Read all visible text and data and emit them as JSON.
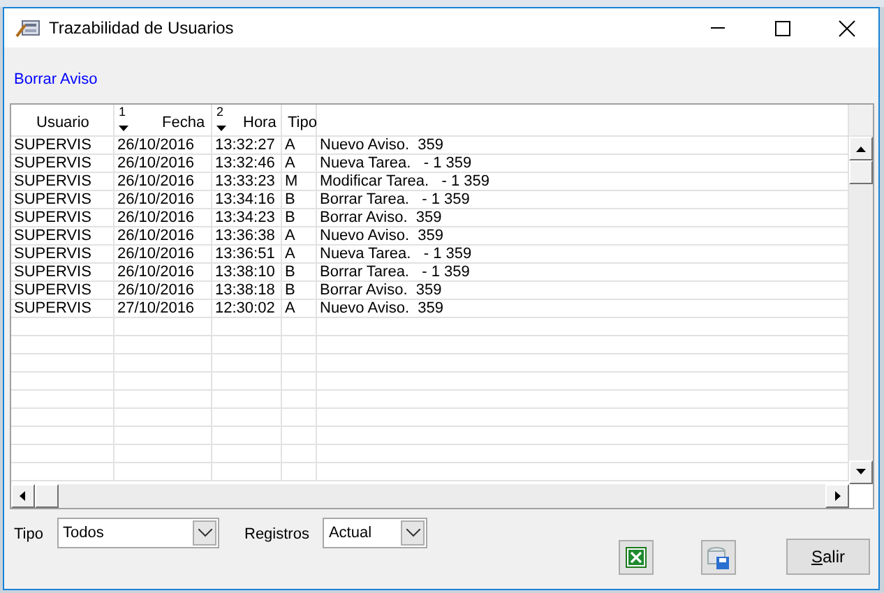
{
  "window": {
    "title": "Trazabilidad de Usuarios"
  },
  "link": "Borrar Aviso",
  "table": {
    "columns": [
      {
        "label": "Usuario"
      },
      {
        "label": "Fecha",
        "sort_order": "1"
      },
      {
        "label": "Hora",
        "sort_order": "2"
      },
      {
        "label": "Tipo"
      },
      {}
    ],
    "rows": [
      [
        "SUPERVIS",
        "26/10/2016",
        "13:32:27",
        "A",
        "Nuevo Aviso.  359"
      ],
      [
        "SUPERVIS",
        "26/10/2016",
        "13:32:46",
        "A",
        "Nueva Tarea.   - 1 359"
      ],
      [
        "SUPERVIS",
        "26/10/2016",
        "13:33:23",
        "M",
        "Modificar Tarea.   - 1 359"
      ],
      [
        "SUPERVIS",
        "26/10/2016",
        "13:34:16",
        "B",
        "Borrar Tarea.   - 1 359"
      ],
      [
        "SUPERVIS",
        "26/10/2016",
        "13:34:23",
        "B",
        "Borrar Aviso.  359"
      ],
      [
        "SUPERVIS",
        "26/10/2016",
        "13:36:38",
        "A",
        "Nuevo Aviso.  359"
      ],
      [
        "SUPERVIS",
        "26/10/2016",
        "13:36:51",
        "A",
        "Nueva Tarea.   - 1 359"
      ],
      [
        "SUPERVIS",
        "26/10/2016",
        "13:38:10",
        "B",
        "Borrar Tarea.   - 1 359"
      ],
      [
        "SUPERVIS",
        "26/10/2016",
        "13:38:18",
        "B",
        "Borrar Aviso.  359"
      ],
      [
        "SUPERVIS",
        "27/10/2016",
        "12:30:02",
        "A",
        "Nuevo Aviso.  359"
      ]
    ]
  },
  "filters": [
    {
      "label": "Tipo",
      "value": "Todos"
    },
    {
      "label": "Registros",
      "value": "Actual"
    }
  ],
  "buttons": {
    "exit": "Salir"
  }
}
